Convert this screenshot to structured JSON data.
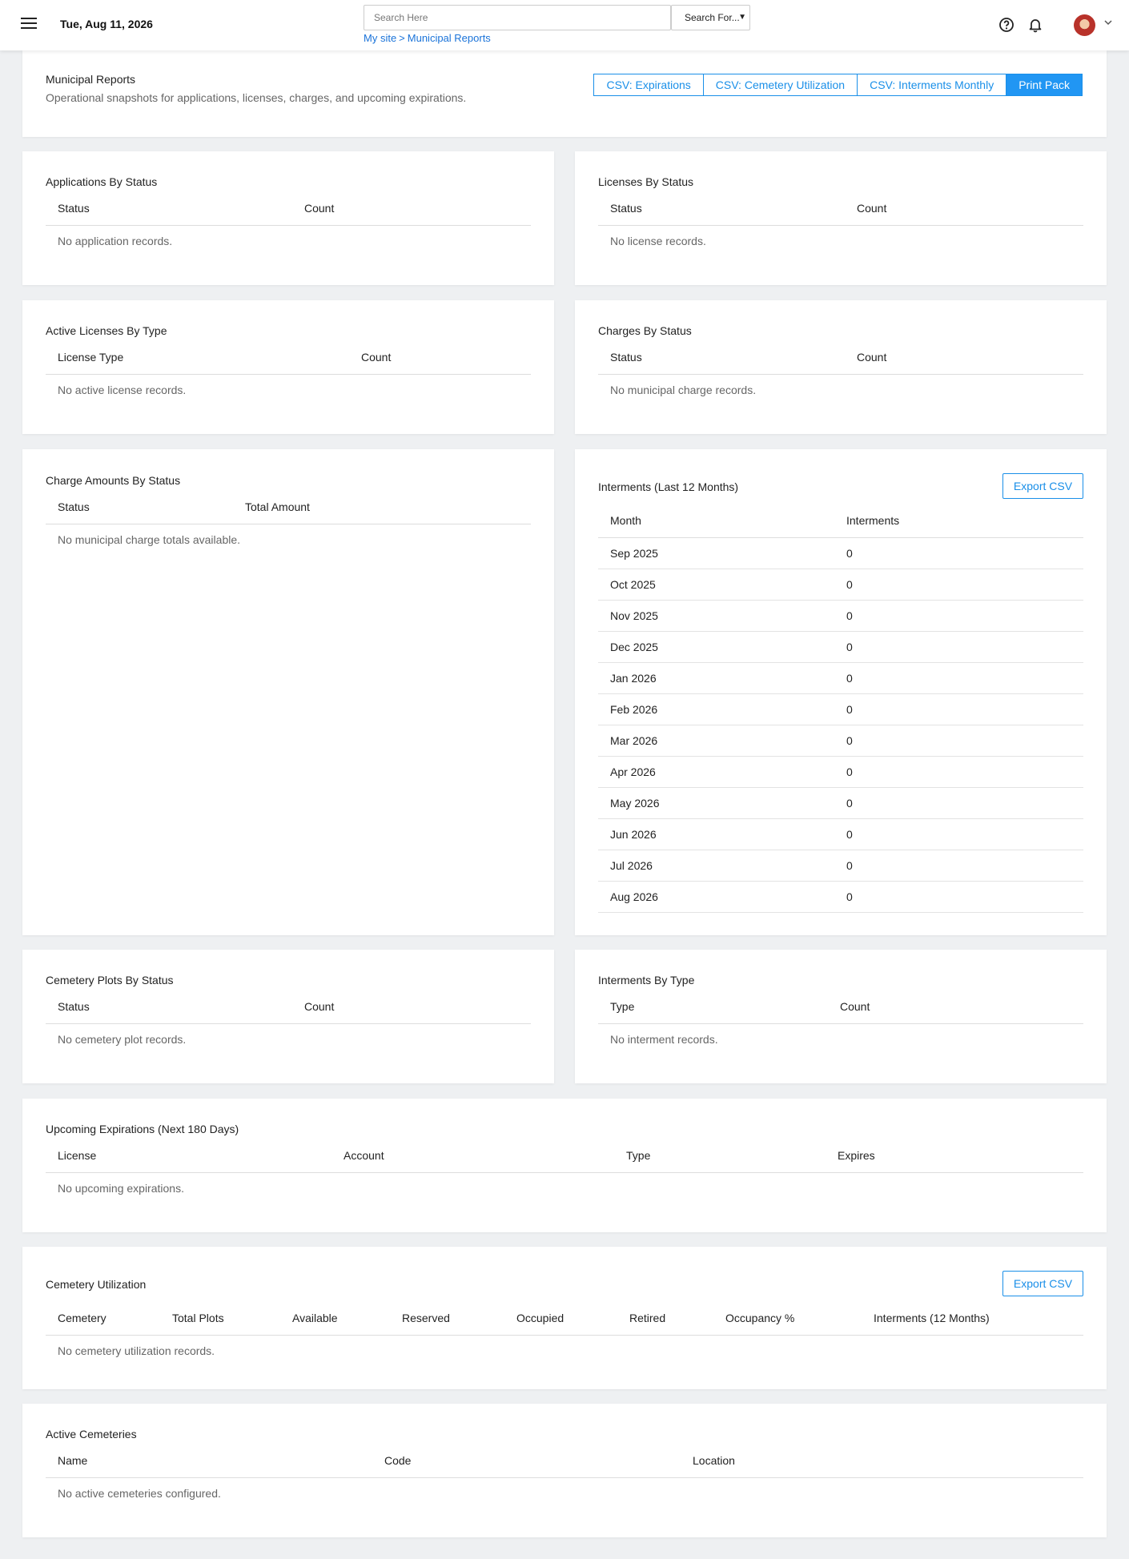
{
  "header": {
    "date": "Tue, Aug 11, 2026",
    "search_placeholder": "Search Here",
    "search_select": "Search For...",
    "breadcrumb": [
      "My site",
      "Municipal Reports"
    ],
    "breadcrumb_sep": ">"
  },
  "reports": {
    "title": "Municipal Reports",
    "subtitle": "Operational snapshots for applications, licenses, charges, and upcoming expirations.",
    "buttons": [
      "CSV: Expirations",
      "CSV: Cemetery Utilization",
      "CSV: Interments Monthly",
      "Print Pack"
    ]
  },
  "export_label": "Export CSV",
  "applications": {
    "title": "Applications By Status",
    "cols": [
      "Status",
      "Count"
    ],
    "empty": "No application records."
  },
  "licenses": {
    "title": "Licenses By Status",
    "cols": [
      "Status",
      "Count"
    ],
    "empty": "No license records."
  },
  "active_licenses": {
    "title": "Active Licenses By Type",
    "cols": [
      "License Type",
      "Count"
    ],
    "empty": "No active license records."
  },
  "charges": {
    "title": "Charges By Status",
    "cols": [
      "Status",
      "Count"
    ],
    "empty": "No municipal charge records."
  },
  "charge_amounts": {
    "title": "Charge Amounts By Status",
    "cols": [
      "Status",
      "Total Amount"
    ],
    "empty": "No municipal charge totals available."
  },
  "interments_monthly": {
    "title": "Interments (Last 12 Months)",
    "cols": [
      "Month",
      "Interments"
    ],
    "rows": [
      [
        "Sep 2025",
        "0"
      ],
      [
        "Oct 2025",
        "0"
      ],
      [
        "Nov 2025",
        "0"
      ],
      [
        "Dec 2025",
        "0"
      ],
      [
        "Jan 2026",
        "0"
      ],
      [
        "Feb 2026",
        "0"
      ],
      [
        "Mar 2026",
        "0"
      ],
      [
        "Apr 2026",
        "0"
      ],
      [
        "May 2026",
        "0"
      ],
      [
        "Jun 2026",
        "0"
      ],
      [
        "Jul 2026",
        "0"
      ],
      [
        "Aug 2026",
        "0"
      ]
    ]
  },
  "plots": {
    "title": "Cemetery Plots By Status",
    "cols": [
      "Status",
      "Count"
    ],
    "empty": "No cemetery plot records."
  },
  "interments_type": {
    "title": "Interments By Type",
    "cols": [
      "Type",
      "Count"
    ],
    "empty": "No interment records."
  },
  "expirations": {
    "title": "Upcoming Expirations (Next 180 Days)",
    "cols": [
      "License",
      "Account",
      "Type",
      "Expires"
    ],
    "empty": "No upcoming expirations."
  },
  "utilization": {
    "title": "Cemetery Utilization",
    "cols": [
      "Cemetery",
      "Total Plots",
      "Available",
      "Reserved",
      "Occupied",
      "Retired",
      "Occupancy %",
      "Interments (12 Months)"
    ],
    "empty": "No cemetery utilization records."
  },
  "active_cemeteries": {
    "title": "Active Cemeteries",
    "cols": [
      "Name",
      "Code",
      "Location"
    ],
    "empty": "No active cemeteries configured."
  }
}
